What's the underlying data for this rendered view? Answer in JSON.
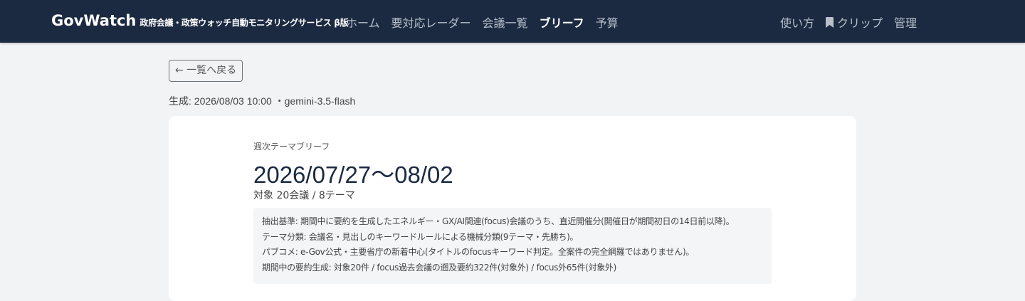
{
  "header": {
    "brand": "GovWatch",
    "brand_sub": "政府会議・政策ウォッチ自動モニタリングサービス β版",
    "nav": [
      {
        "label": "ホーム",
        "active": false
      },
      {
        "label": "要対応レーダー",
        "active": false
      },
      {
        "label": "会議一覧",
        "active": false
      },
      {
        "label": "ブリーフ",
        "active": true
      },
      {
        "label": "予算",
        "active": false
      }
    ],
    "right_nav": {
      "help": "使い方",
      "clip": "クリップ",
      "clip_icon": "bookmark-icon",
      "admin": "管理"
    }
  },
  "back_button": "← 一覧へ戻る",
  "meta": "生成: 2026/08/03 10:00 ・gemini-3.5-flash",
  "brief": {
    "eyebrow": "週次テーマブリーフ",
    "title": "2026/07/27〜08/02",
    "scope": "対象 20会議 / 8テーマ",
    "notes": [
      "抽出基準: 期間中に要約を生成したエネルギー・GX/AI関連(focus)会議のうち、直近開催分(開催日が期間初日の14日前以降)。",
      "テーマ分類: 会議名・見出しのキーワードルールによる機械分類(9テーマ・先勝ち)。",
      "パブコメ: e-Gov公式・主要省庁の新着中心(タイトルのfocusキーワード判定。全案件の完全網羅ではありません)。",
      "期間中の要約生成: 対象20件 / focus過去会議の遡及要約322件(対象外) / focus外65件(対象外)"
    ]
  },
  "colors": {
    "navbar_bg": "#1b2a41",
    "page_bg": "#f2f3f5",
    "title_color": "#1b2a41"
  }
}
